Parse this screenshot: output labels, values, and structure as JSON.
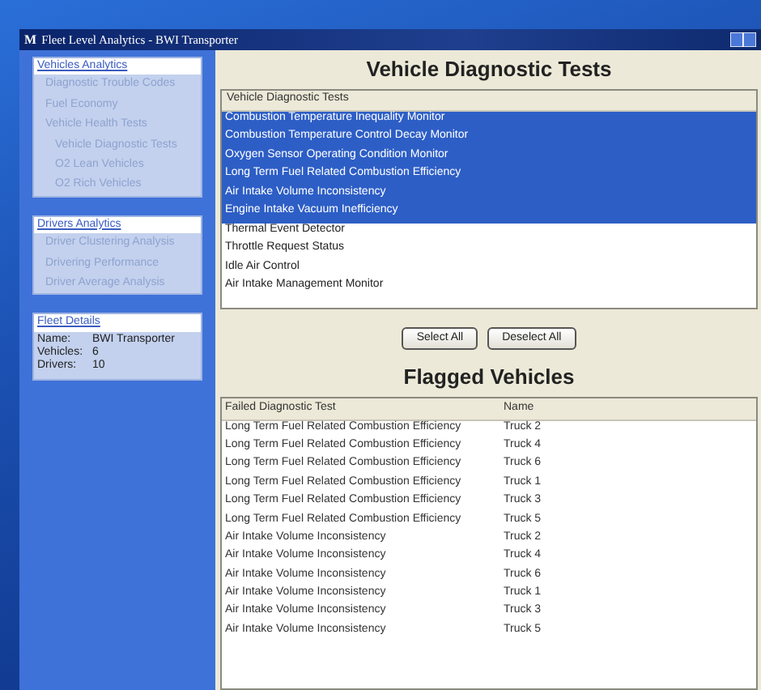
{
  "window": {
    "icon": "M",
    "title": "Fleet Level Analytics - BWI Transporter"
  },
  "sidebar": {
    "sections": [
      {
        "title": "Vehicles Analytics",
        "items": [
          {
            "label": "Diagnostic Trouble Codes"
          },
          {
            "label": "Fuel Economy"
          },
          {
            "label": "Vehicle Health Tests",
            "children": [
              {
                "label": "Vehicle Diagnostic Tests"
              },
              {
                "label": "O2 Lean Vehicles"
              },
              {
                "label": "O2 Rich Vehicles"
              }
            ]
          }
        ]
      },
      {
        "title": "Drivers Analytics",
        "items": [
          {
            "label": "Driver Clustering Analysis"
          },
          {
            "label": "Drivering Performance"
          },
          {
            "label": "Driver Average Analysis"
          }
        ]
      }
    ],
    "fleet_details": {
      "title": "Fleet Details",
      "fields": [
        {
          "label": "Name:",
          "value": "BWI Transporter"
        },
        {
          "label": "Vehicles:",
          "value": "6"
        },
        {
          "label": "Drivers:",
          "value": "10"
        }
      ]
    }
  },
  "main": {
    "title": "Vehicle Diagnostic Tests",
    "tests": {
      "column": "Vehicle Diagnostic Tests",
      "items": [
        {
          "label": "Combustion Temperature Inequality Monitor",
          "selected": true
        },
        {
          "label": "Combustion Temperature Control Decay Monitor",
          "selected": true
        },
        {
          "label": "Oxygen Sensor Operating Condition Monitor",
          "selected": true
        },
        {
          "label": "Long Term Fuel Related Combustion Efficiency",
          "selected": true
        },
        {
          "label": "Air Intake Volume Inconsistency",
          "selected": true
        },
        {
          "label": "Engine Intake Vacuum Inefficiency",
          "selected": true
        },
        {
          "label": "Thermal Event Detector",
          "selected": false
        },
        {
          "label": "Throttle Request Status",
          "selected": false
        },
        {
          "label": "Idle Air Control",
          "selected": false
        },
        {
          "label": "Air Intake Management Monitor",
          "selected": false
        }
      ]
    },
    "buttons": [
      "Select All",
      "Deselect All"
    ],
    "flagged": {
      "title": "Flagged Vehicles",
      "columns": [
        "Failed Diagnostic Test",
        "Name"
      ],
      "rows": [
        [
          "Long Term Fuel Related Combustion Efficiency",
          "Truck 2"
        ],
        [
          "Long Term Fuel Related Combustion Efficiency",
          "Truck 4"
        ],
        [
          "Long Term Fuel Related Combustion Efficiency",
          "Truck 6"
        ],
        [
          "Long Term Fuel Related Combustion Efficiency",
          "Truck 1"
        ],
        [
          "Long Term Fuel Related Combustion Efficiency",
          "Truck 3"
        ],
        [
          "Long Term Fuel Related Combustion Efficiency",
          "Truck 5"
        ],
        [
          "Air Intake Volume Inconsistency",
          "Truck 2"
        ],
        [
          "Air Intake Volume Inconsistency",
          "Truck 4"
        ],
        [
          "Air Intake Volume Inconsistency",
          "Truck 6"
        ],
        [
          "Air Intake Volume Inconsistency",
          "Truck 1"
        ],
        [
          "Air Intake Volume Inconsistency",
          "Truck 3"
        ],
        [
          "Air Intake Volume Inconsistency",
          "Truck 5"
        ]
      ]
    }
  }
}
